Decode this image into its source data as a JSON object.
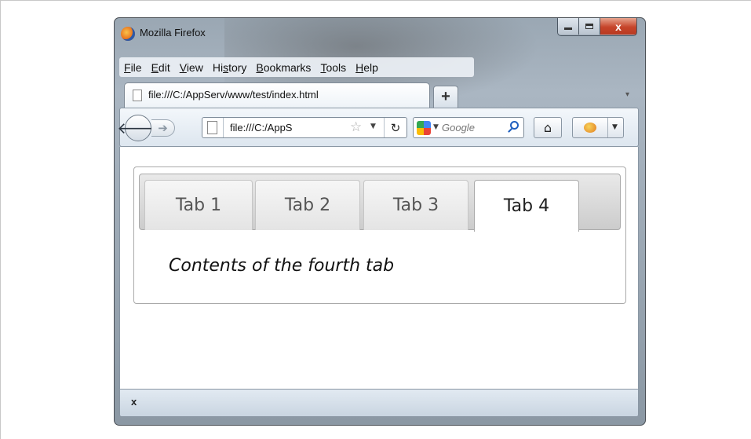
{
  "window": {
    "title": "Mozilla Firefox",
    "minimize_glyph": "",
    "close_glyph": "x"
  },
  "menu": [
    {
      "underline": "F",
      "rest": "ile"
    },
    {
      "underline": "E",
      "rest": "dit"
    },
    {
      "underline": "V",
      "rest": "iew"
    },
    {
      "pre": "Hi",
      "underline": "s",
      "rest": "tory"
    },
    {
      "underline": "B",
      "rest": "ookmarks"
    },
    {
      "underline": "T",
      "rest": "ools"
    },
    {
      "underline": "H",
      "rest": "elp"
    }
  ],
  "browser_tab": {
    "title": "file:///C:/AppServ/www/test/index.html",
    "new_tab_label": "+"
  },
  "nav": {
    "url_text": "file:///C:/AppS",
    "search_placeholder": "Google"
  },
  "page": {
    "tabs": [
      "Tab 1",
      "Tab 2",
      "Tab 3",
      "Tab 4"
    ],
    "active_tab_index": 3,
    "panel_text": "Contents of the fourth tab"
  },
  "status": {
    "close_label": "x"
  },
  "icons": {
    "back": "back-arrow-icon",
    "forward": "forward-arrow-icon",
    "star": "bookmark-star-icon",
    "reload": "reload-icon",
    "home": "home-icon",
    "search": "magnifier-icon"
  }
}
